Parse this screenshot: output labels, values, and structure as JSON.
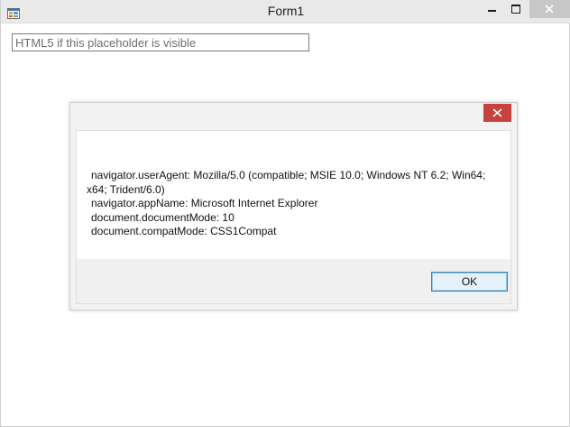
{
  "window": {
    "title": "Form1",
    "app_icon": "form-app-icon",
    "controls": {
      "minimize_icon": "minimize-icon",
      "maximize_icon": "maximize-icon",
      "close_icon": "close-icon"
    }
  },
  "textbox": {
    "placeholder": "HTML5 if this placeholder is visible"
  },
  "message_box": {
    "close_icon": "close-icon",
    "lines": [
      "navigator.userAgent: Mozilla/5.0 (compatible; MSIE 10.0; Windows NT 6.2; Win64;",
      "x64; Trident/6.0)",
      "navigator.appName: Microsoft Internet Explorer",
      "document.documentMode: 10",
      "document.compatMode: CSS1Compat"
    ],
    "ok_label": "OK"
  },
  "colors": {
    "close_accent": "#c7413e",
    "ok_button_border": "#3c7fb1"
  }
}
